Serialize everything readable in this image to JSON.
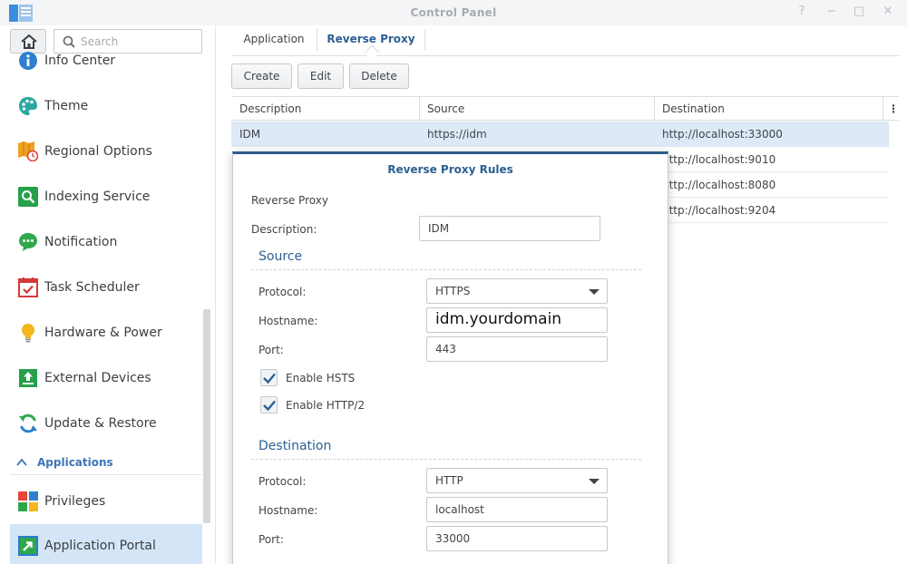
{
  "window": {
    "title": "Control Panel",
    "help_glyph": "?",
    "minimize_glyph": "−",
    "maximize_glyph": "□",
    "close_glyph": "✕"
  },
  "sidebar": {
    "search_placeholder": "Search",
    "items": [
      {
        "label": "Info Center",
        "icon": "info-icon"
      },
      {
        "label": "Theme",
        "icon": "palette-icon"
      },
      {
        "label": "Regional Options",
        "icon": "map-clock-icon"
      },
      {
        "label": "Indexing Service",
        "icon": "magnifier-icon"
      },
      {
        "label": "Notification",
        "icon": "chat-bubble-icon"
      },
      {
        "label": "Task Scheduler",
        "icon": "calendar-check-icon"
      },
      {
        "label": "Hardware & Power",
        "icon": "lightbulb-icon"
      },
      {
        "label": "External Devices",
        "icon": "upload-box-icon"
      },
      {
        "label": "Update & Restore",
        "icon": "refresh-icon"
      }
    ],
    "section_label": "Applications",
    "app_items": [
      {
        "label": "Privileges",
        "icon": "colored-squares-icon"
      },
      {
        "label": "Application Portal",
        "icon": "portal-arrow-icon",
        "active": true
      }
    ]
  },
  "tabs": [
    {
      "label": "Application",
      "active": false
    },
    {
      "label": "Reverse Proxy",
      "active": true
    }
  ],
  "toolbar": {
    "create": "Create",
    "edit": "Edit",
    "delete": "Delete"
  },
  "table": {
    "columns": [
      "Description",
      "Source",
      "Destination"
    ],
    "menu_glyph": "⋮",
    "rows": [
      {
        "description": "IDM",
        "source": "https://idm",
        "destination": "http://localhost:33000",
        "selected": true
      },
      {
        "description": "",
        "source": "",
        "destination": "http://localhost:9010"
      },
      {
        "description": "",
        "source": "",
        "destination": "http://localhost:8080"
      },
      {
        "description": "",
        "source": "",
        "destination": "http://localhost:9204"
      }
    ]
  },
  "dialog": {
    "title": "Reverse Proxy Rules",
    "subtitle": "Reverse Proxy",
    "description_label": "Description:",
    "description_value": "IDM",
    "source": {
      "section": "Source",
      "protocol_label": "Protocol:",
      "protocol_value": "HTTPS",
      "hostname_label": "Hostname:",
      "hostname_value": "idm.yourdomain",
      "port_label": "Port:",
      "port_value": "443",
      "hsts_label": "Enable HSTS",
      "hsts_checked": true,
      "http2_label": "Enable HTTP/2",
      "http2_checked": true
    },
    "destination": {
      "section": "Destination",
      "protocol_label": "Protocol:",
      "protocol_value": "HTTP",
      "hostname_label": "Hostname:",
      "hostname_value": "localhost",
      "port_label": "Port:",
      "port_value": "33000"
    }
  },
  "colors": {
    "accent": "#2c5f93",
    "selection": "#dde9f6",
    "sidebar_active": "#d4e5f7"
  }
}
